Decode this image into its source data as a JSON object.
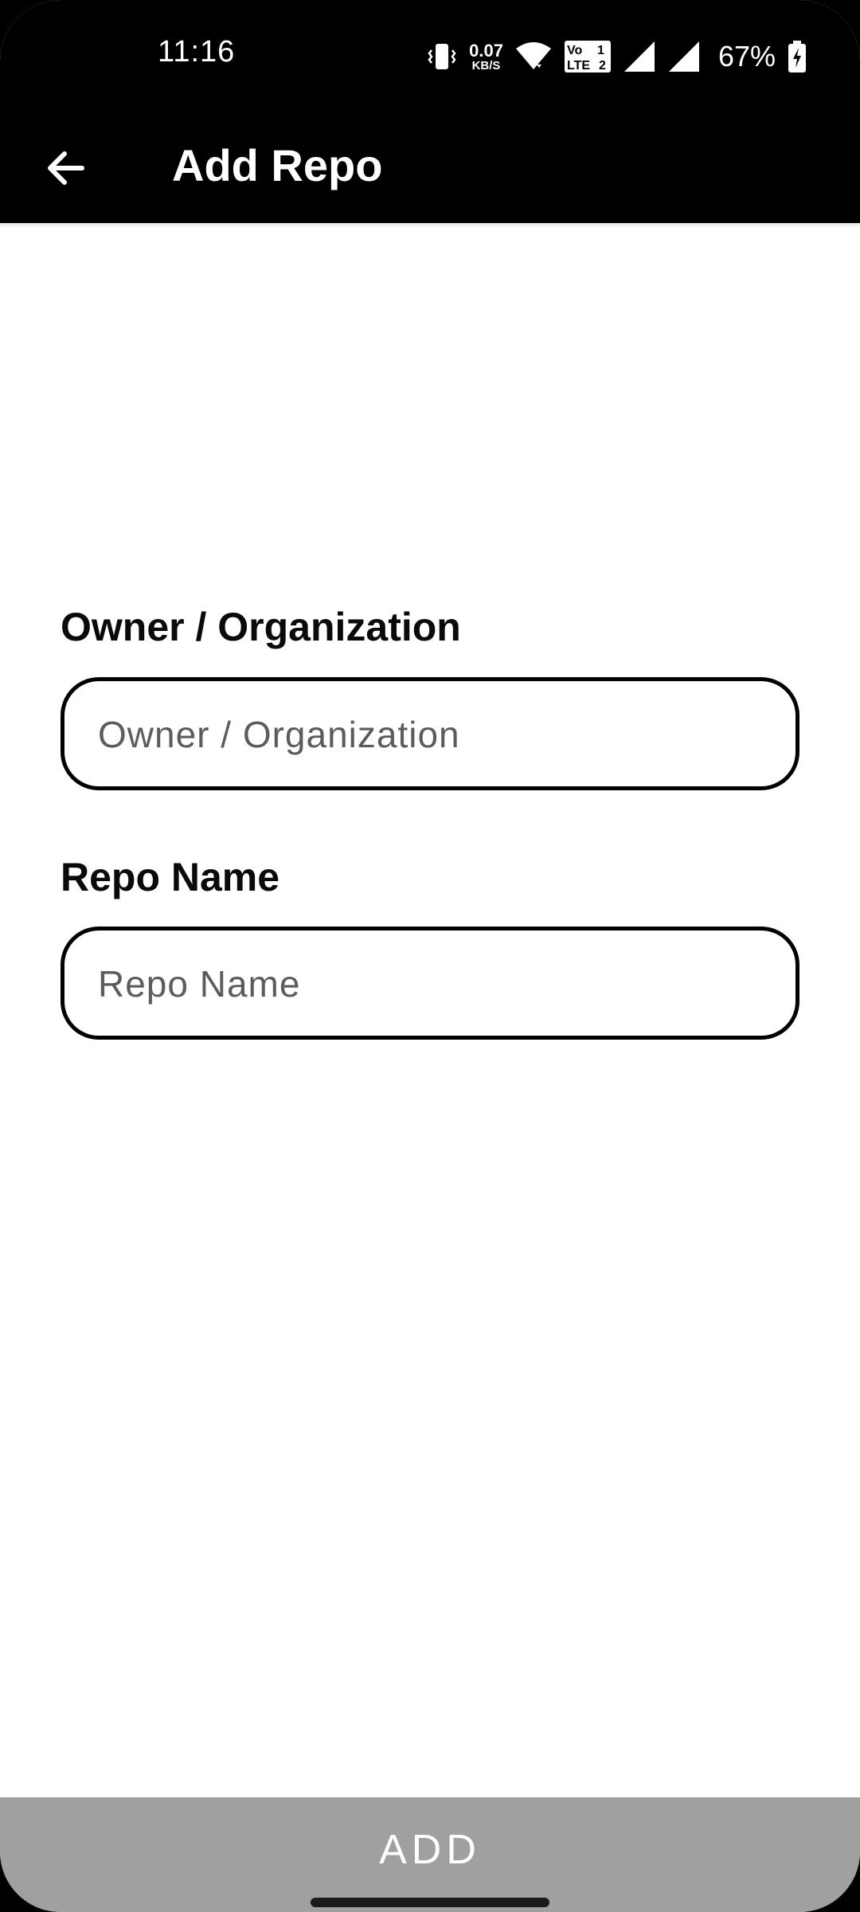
{
  "status_bar": {
    "time": "11:16",
    "net_speed_value": "0.07",
    "net_speed_unit": "KB/S",
    "battery_percent": "67%",
    "icons": [
      "vibrate-icon",
      "wifi-icon",
      "volte-lte2-icon",
      "signal-icon",
      "signal-icon",
      "battery-charging-icon"
    ]
  },
  "app_bar": {
    "back_icon": "arrow-back-icon",
    "title": "Add Repo"
  },
  "form": {
    "owner": {
      "label": "Owner / Organization",
      "placeholder": "Owner / Organization",
      "value": ""
    },
    "repo": {
      "label": "Repo Name",
      "placeholder": "Repo Name",
      "value": ""
    }
  },
  "actions": {
    "add_label": "ADD"
  },
  "colors": {
    "app_bar_bg": "#000000",
    "button_disabled_bg": "#a0a0a0",
    "field_border": "#000000"
  }
}
